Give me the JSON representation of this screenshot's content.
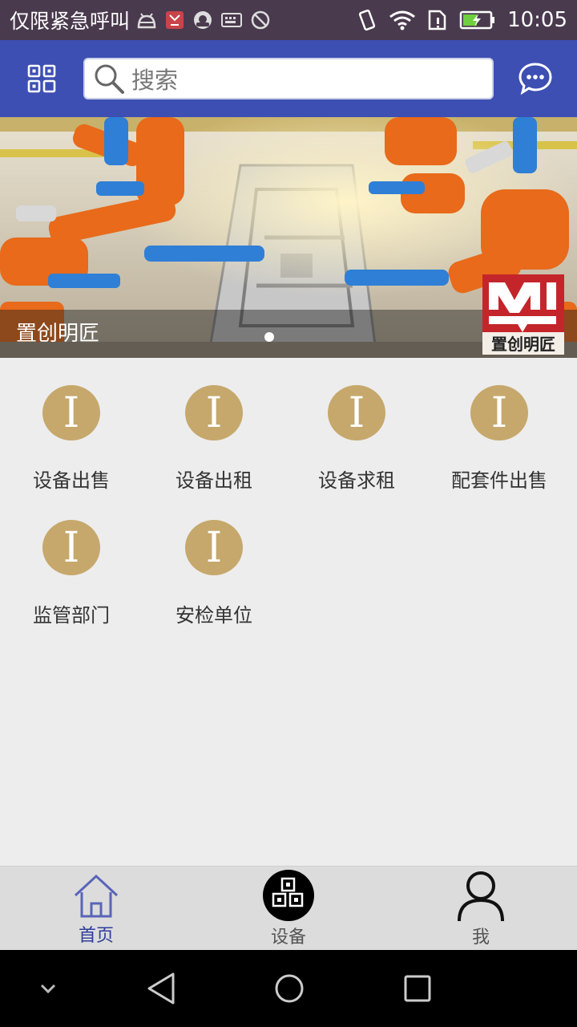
{
  "status_bar": {
    "carrier": "仅限紧急呼叫",
    "time": "10:05",
    "icons": [
      "android-debug-icon",
      "notification-app-icon",
      "support-headset-icon",
      "keyboard-icon",
      "location-off-icon",
      "vibrate-icon",
      "wifi-icon",
      "sim-alert-icon",
      "battery-charging-icon"
    ]
  },
  "header": {
    "search_placeholder": "搜索",
    "left_icon": "qr-scan-icon",
    "right_icon": "message-icon"
  },
  "banner": {
    "caption": "置创明匠",
    "logo_text": "置创明匠",
    "logo_mark": "MI",
    "slide_count": 1,
    "active_slide": 1
  },
  "categories": [
    {
      "label": "设备出售",
      "icon_glyph": "I"
    },
    {
      "label": "设备出租",
      "icon_glyph": "I"
    },
    {
      "label": "设备求租",
      "icon_glyph": "I"
    },
    {
      "label": "配套件出售",
      "icon_glyph": "I"
    },
    {
      "label": "监管部门",
      "icon_glyph": "I"
    },
    {
      "label": "安检单位",
      "icon_glyph": "I"
    }
  ],
  "tabbar": {
    "tabs": [
      {
        "label": "首页",
        "icon": "home-icon",
        "active": true
      },
      {
        "label": "设备",
        "icon": "device-grid-icon",
        "active": false
      },
      {
        "label": "我",
        "icon": "profile-icon",
        "active": false
      }
    ]
  },
  "navbar": {
    "buttons": [
      "collapse-icon",
      "back-icon",
      "home-circle-icon",
      "recents-icon"
    ]
  },
  "colors": {
    "status_bar": "#4a3a4e",
    "header": "#3d4fb3",
    "category_icon": "#c6a86c",
    "background": "#ededed",
    "tab_active": "#2e3d9a"
  }
}
